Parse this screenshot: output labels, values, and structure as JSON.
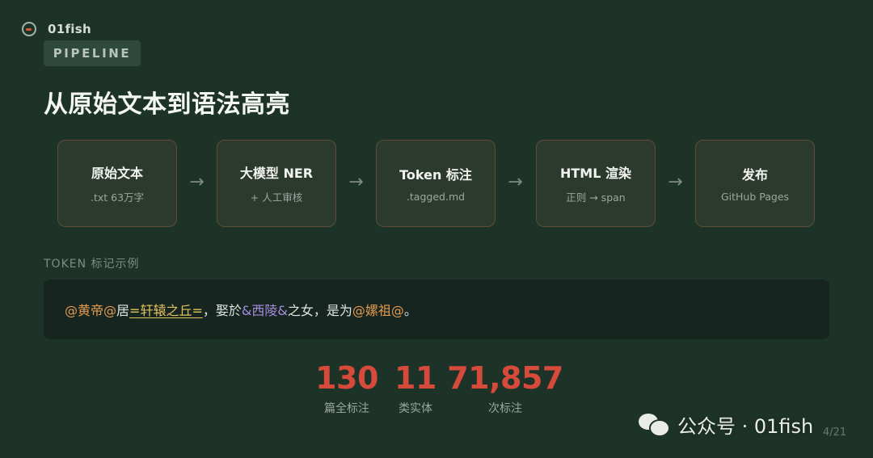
{
  "brand": {
    "name": "01fish",
    "logo_icon": "fish-logo-icon"
  },
  "badge": "PIPELINE",
  "title": "从原始文本到语法高亮",
  "pipeline": {
    "steps": [
      {
        "title": "原始文本",
        "sub": ".txt 63万字"
      },
      {
        "title": "大模型 NER",
        "sub": "+ 人工审核"
      },
      {
        "title": "Token 标注",
        "sub": ".tagged.md"
      },
      {
        "title": "HTML 渲染",
        "sub": "正则 → span"
      },
      {
        "title": "发布",
        "sub": "GitHub Pages"
      }
    ],
    "arrow": "→"
  },
  "section_label": "TOKEN 标记示例",
  "example": {
    "segments": [
      {
        "text": "@黄帝@",
        "type": "person"
      },
      {
        "text": "居",
        "type": "plain"
      },
      {
        "text": "=轩辕之丘=",
        "type": "place"
      },
      {
        "text": "，娶於",
        "type": "plain"
      },
      {
        "text": "&西陵&",
        "type": "clan"
      },
      {
        "text": "之女，是为",
        "type": "plain"
      },
      {
        "text": "@嫘祖@",
        "type": "person"
      },
      {
        "text": "。",
        "type": "plain"
      }
    ],
    "colors": {
      "person": "#e39a4f",
      "place": "#e2c25a",
      "clan": "#a98be0",
      "plain": "#dfe4e0"
    }
  },
  "stats": [
    {
      "value": "130",
      "label": "篇全标注"
    },
    {
      "value": "11",
      "label": "类实体"
    },
    {
      "value": "71,857",
      "label": "次标注"
    }
  ],
  "watermark": {
    "text": "公众号 · 01fish",
    "icon": "wechat-icon"
  },
  "page_indicator": "4/21",
  "colors": {
    "background": "#1e3328",
    "accent": "#d64a3c",
    "card_border": "#5e4d38",
    "code_bg": "#162520"
  }
}
